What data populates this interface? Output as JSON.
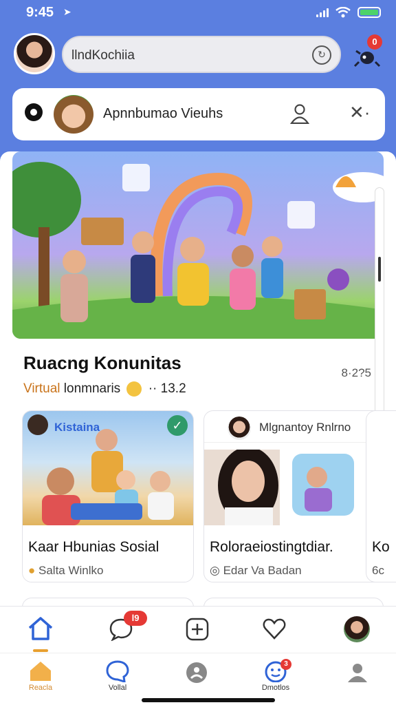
{
  "status_bar": {
    "time": "9:45"
  },
  "header": {
    "search_text": "llndKochiia",
    "notification_count": "0"
  },
  "notification_card": {
    "title": "Apnnbumao Vieuhs"
  },
  "section": {
    "title": "Ruacng Konunitas",
    "subtitle_accent": "Virtual",
    "subtitle_rest": "lonmnaris",
    "subtitle_value": "·· 13.2",
    "count": "8·2?5"
  },
  "cards": [
    {
      "banner": "Kistaina",
      "caption": "Kaar Hbunias Sosial",
      "sub": "Salta Winlko"
    },
    {
      "header_name": "Mlgnantoy Rnlrno",
      "caption": "Roloraeiostingtdiar.",
      "sub": "Edar Va Badan"
    },
    {
      "caption": "Ko",
      "sub": "6c"
    }
  ],
  "bottom_nav_top": {
    "chat_badge": "l9"
  },
  "bottom_nav": [
    {
      "label": "Reacla"
    },
    {
      "label": "Vollal"
    },
    {
      "label": ""
    },
    {
      "label": "Dmotlos",
      "badge": "3"
    },
    {
      "label": ""
    }
  ],
  "colors": {
    "app_background": "#5b7fe0",
    "accent_blue": "#2f63d6",
    "accent_orange": "#c9731a",
    "badge_red": "#e53935",
    "check_green": "#2f9a6a"
  }
}
